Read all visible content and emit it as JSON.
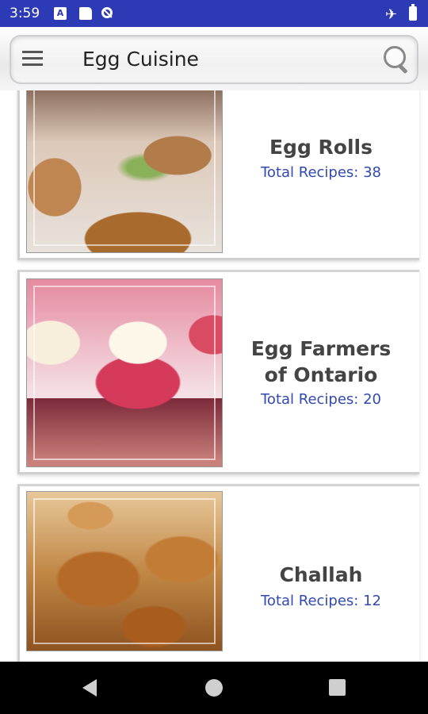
{
  "status_bar": {
    "time": "3:59",
    "notification_icons": [
      "a-icon",
      "sd-card-icon",
      "no-data-icon"
    ],
    "right_icons": [
      "airplane-icon",
      "battery-icon"
    ]
  },
  "toolbar": {
    "title": "Egg Cuisine"
  },
  "categories": [
    {
      "title": "Egg Rolls",
      "subtitle": "Total Recipes: 38"
    },
    {
      "title": "Egg Farmers of Ontario",
      "subtitle": "Total Recipes: 20"
    },
    {
      "title": "Challah",
      "subtitle": "Total Recipes: 12"
    }
  ],
  "colors": {
    "status_bar": "#2d3ab5",
    "subtitle_text": "#3249b0",
    "title_text": "#444444"
  }
}
